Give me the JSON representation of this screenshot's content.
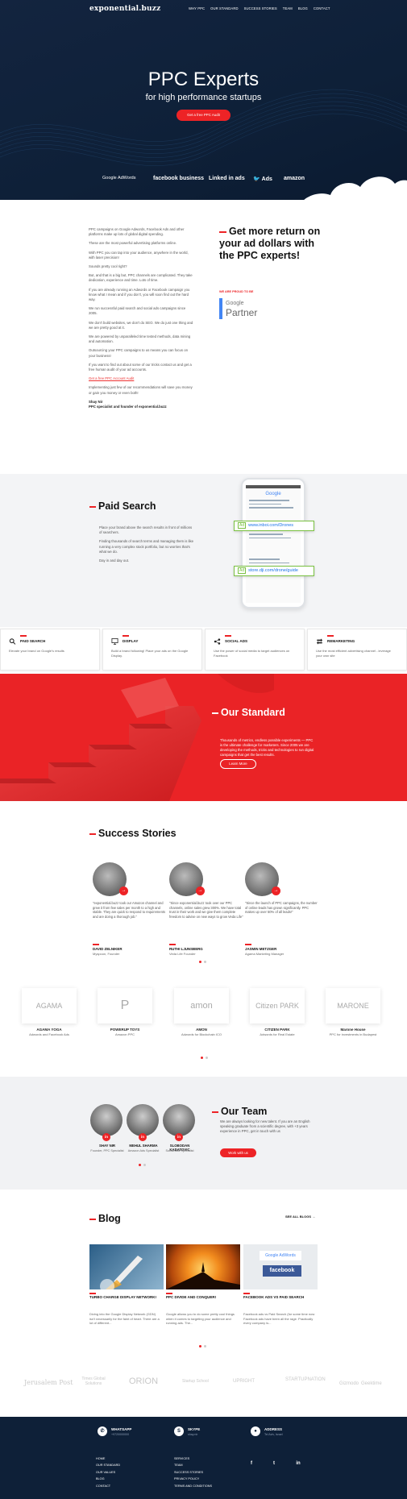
{
  "header": {
    "logo": "exponential.buzz",
    "nav": [
      "WHY PPC",
      "OUR STANDARD",
      "SUCCESS STORIES",
      "TEAM",
      "BLOG",
      "CONTACT"
    ]
  },
  "hero": {
    "title": "PPC Experts",
    "subtitle": "for high performance startups",
    "button": "Get a free PPC Audit",
    "partners": [
      "Google AdWords",
      "facebook business",
      "Linked in ads",
      "Ads",
      "amazon"
    ]
  },
  "intro": {
    "paragraphs": [
      "PPC campaigns on Google Adwords, Facebook Ads and other platforms make up lots of global digital spending.",
      "These are the most powerful advertising platforms online.",
      "With PPC you can tap into your audience, anywhere in the world, with laser precision!",
      "Sounds pretty cool right?",
      "But, and that is a big but, PPC channels are complicated. They take dedication, experience and time. Lots of time.",
      "If you are already running an Adwords or Facebook campaign you know what I mean and if you don't, you will soon find out the hard way.",
      "We run successful paid search and social ads campaigns since 2005.",
      "We don't build websites, we don't do SEO. We do just one thing and we are pretty good at it.",
      "We are powered by unparalleled time tested methods, data mining and automation.",
      "Outsourcing your PPC campaigns to us means you can focus on your business!",
      "If you want to find out about some of our tricks contact us and get a free human audit of your ad accounts.",
      "Implementing just few of our recommendations will save you money or gain you money or even both!"
    ],
    "link": "Get a free PPC Account Audit",
    "signature_name": "Shay Nir",
    "signature_role": "PPC specialist and founder of exponential.buzz",
    "cta": "Get more return on your ad dollars with the PPC experts!",
    "proud": "WE ARE PROUD TO BE",
    "badge_google": "Google",
    "badge_partner": "Partner"
  },
  "paid_search": {
    "title": "Paid Search",
    "paragraphs": [
      "Place your brand above the search results in front of millions of searchers.",
      "Finding thousands of search terms and managing them is like running a very complex stock portfolio, but no worries that's what we do.",
      "Day in and day out."
    ],
    "ad1_tag": "Ad",
    "ad1_url": "www.inboi.com/Drones",
    "ad2_tag": "Ad",
    "ad2_url": "store.dji.com/drone/guide",
    "phone_brand": "Google"
  },
  "services": [
    {
      "title": "PAID SEARCH",
      "desc": "Elevate your brand on Google's results",
      "icon": "search-icon"
    },
    {
      "title": "DISPLAY",
      "desc": "Build a brand following! Place your ads on the Google Display.",
      "icon": "monitor-icon"
    },
    {
      "title": "SOCIAL ADS",
      "desc": "Use the power of social media to target audiences on Facebook",
      "icon": "social-icon"
    },
    {
      "title": "REMARKETING",
      "desc": "Use the most efficient advertising channel - leverage your own site",
      "icon": "remarketing-icon"
    }
  ],
  "standard": {
    "title": "Our Standard",
    "text": "Thousands of metrics, endless possible experiments — PPC is the ultimate challenge for marketers. Since 2005 we are developing the methods, tricks and technologies to run digital campaigns that get the best results.",
    "button": "Learn More"
  },
  "success": {
    "title": "Success Stories",
    "testimonials": [
      {
        "quote": "\"exponential.buzz took our Amazon channel and grew it from few sales per month to a high and stable. They are quick to respond to requirements and are doing a thorough job.\"",
        "name": "DAVID ZELNIKER",
        "role": "Myspoon, Founder"
      },
      {
        "quote": "\"Since exponential.buzz took over our PPC channels, online sales grew 300%. We have total trust in their work and we give them complete freedom to advise on new ways to grow Veda Life\"",
        "name": "RUTHI LJUNSBERG",
        "role": "Veda Life Founder"
      },
      {
        "quote": "\"Since the launch of PPC campaigns, the number of online leads has grown significantly. PPC makes up over 50% of all leads!\"",
        "name": "JASMIN METZGER",
        "role": "Agama Marketing Manager"
      }
    ],
    "clients": [
      {
        "logo": "AGAMA",
        "name": "AGAMA YOGA",
        "service": "Adwords and Facebook Ads"
      },
      {
        "logo": "P",
        "name": "POWERUP TOYS",
        "service": "Amazon PPC"
      },
      {
        "logo": "amon",
        "name": "AMON",
        "service": "Adwords for Blockchain ICO"
      },
      {
        "logo": "Citizen PARK",
        "name": "CITIZEN PARK",
        "service": "Adwords for Real Estate"
      },
      {
        "logo": "MARONE",
        "name": "Marone House",
        "service": "PPC for investments in Budapest"
      }
    ]
  },
  "team": {
    "title": "Our Team",
    "members": [
      {
        "name": "SHAY NIR",
        "role": "Founder, PPC Specialist"
      },
      {
        "name": "MEHUL SHARMA",
        "role": "Amazon Ads Specialist"
      },
      {
        "name": "SLOBODAN KADATOVIC",
        "role": "Social Ads Specialist"
      }
    ],
    "text": "We are always looking for new talent. If you are an English speaking graduate from a scientific degree, with +3 years experience in PPC, get in touch with us",
    "button": "Work with us",
    "linkedin": "in"
  },
  "blog": {
    "title": "Blog",
    "see_all": "SEE ALL BLOGS →",
    "posts": [
      {
        "title": "TURBO CHARGE DISPLAY NETWORK!",
        "excerpt": "Diving into the Google Display Network (GDN) isn't necessarily for the faint of heart. There are a lot of different..."
      },
      {
        "title": "PPC DIVIDE AND CONQUER!",
        "excerpt": "Google allows you to do some pretty cool things when it comes to targeting your audience and running ads. The..."
      },
      {
        "title": "FACEBOOK ADS VS PAID SEARCH",
        "excerpt": "Facebook ads vs Paid Search (for some time now Facebook ads have been all the rage. Practically every company is..."
      }
    ],
    "post3_google": "Google AdWords",
    "post3_fb": "facebook"
  },
  "featured_logos": [
    "Jerusalem Post",
    "Times Global Solutions",
    "ORION",
    "Startup School",
    "UPRIGHT",
    "STARTUPNATION",
    "Gizmodo",
    "Geektime"
  ],
  "footer": {
    "contacts": [
      {
        "icon": "whatsapp-icon",
        "title": "WHATSAPP",
        "value": "+9720000000"
      },
      {
        "icon": "skype-icon",
        "title": "SKYPE",
        "value": "shay.nir"
      },
      {
        "icon": "location-icon",
        "title": "ADDRESS",
        "value": "Tel Aviv, Israel"
      }
    ],
    "links_col1": [
      "HOME",
      "OUR STANDARD",
      "OUR VALUES",
      "BLOG",
      "CONTACT"
    ],
    "links_col2": [
      "SERVICES",
      "TEAM",
      "SUCCESS STORIES",
      "PRIVACY POLICY",
      "TERMS AND CONDITIONS"
    ],
    "social": [
      "f",
      "t",
      "in"
    ]
  },
  "colors": {
    "accent": "#ed2326",
    "navy": "#0e2038"
  }
}
